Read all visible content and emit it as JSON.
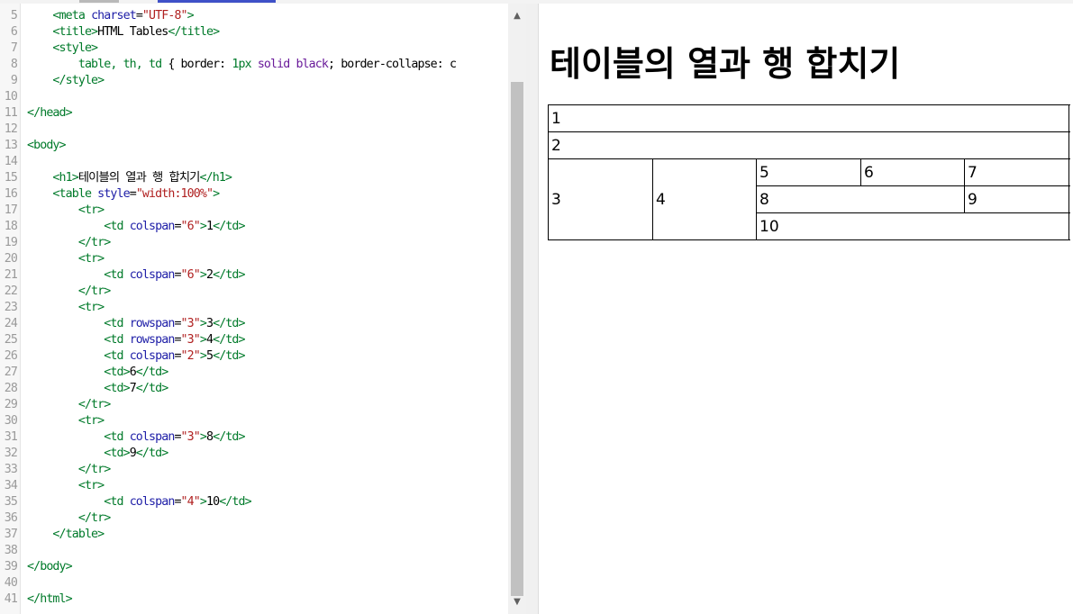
{
  "editor": {
    "lines": [
      {
        "n": "5",
        "tokens": [
          [
            "t",
            "    "
          ],
          [
            "tag",
            "<meta "
          ],
          [
            "attr",
            "charset"
          ],
          [
            "txt",
            "="
          ],
          [
            "str",
            "\"UTF-8\""
          ],
          [
            "tag",
            ">"
          ]
        ]
      },
      {
        "n": "6",
        "tokens": [
          [
            "t",
            "    "
          ],
          [
            "tag",
            "<title>"
          ],
          [
            "txt",
            "HTML Tables"
          ],
          [
            "tag",
            "</title>"
          ]
        ]
      },
      {
        "n": "7",
        "tokens": [
          [
            "t",
            "    "
          ],
          [
            "tag",
            "<style>"
          ]
        ]
      },
      {
        "n": "8",
        "tokens": [
          [
            "t",
            "        "
          ],
          [
            "tag",
            "table, th, td "
          ],
          [
            "txt",
            "{ border: "
          ],
          [
            "tag",
            "1px "
          ],
          [
            "kw",
            "solid "
          ],
          [
            "kw",
            "black"
          ],
          [
            "txt",
            "; border-collapse: c"
          ]
        ]
      },
      {
        "n": "9",
        "tokens": [
          [
            "t",
            "    "
          ],
          [
            "tag",
            "</style>"
          ]
        ]
      },
      {
        "n": "10",
        "tokens": []
      },
      {
        "n": "11",
        "tokens": [
          [
            "tag",
            "</head>"
          ]
        ]
      },
      {
        "n": "12",
        "tokens": []
      },
      {
        "n": "13",
        "tokens": [
          [
            "tag",
            "<body>"
          ]
        ]
      },
      {
        "n": "14",
        "tokens": []
      },
      {
        "n": "15",
        "tokens": [
          [
            "t",
            "    "
          ],
          [
            "tag",
            "<h1>"
          ],
          [
            "txt",
            "테이블의 열과 행 합치기"
          ],
          [
            "tag",
            "</h1>"
          ]
        ]
      },
      {
        "n": "16",
        "tokens": [
          [
            "t",
            "    "
          ],
          [
            "tag",
            "<table "
          ],
          [
            "attr",
            "style"
          ],
          [
            "txt",
            "="
          ],
          [
            "str",
            "\"width:100%\""
          ],
          [
            "tag",
            ">"
          ]
        ]
      },
      {
        "n": "17",
        "tokens": [
          [
            "t",
            "        "
          ],
          [
            "tag",
            "<tr>"
          ]
        ]
      },
      {
        "n": "18",
        "tokens": [
          [
            "t",
            "            "
          ],
          [
            "tag",
            "<td "
          ],
          [
            "attr",
            "colspan"
          ],
          [
            "txt",
            "="
          ],
          [
            "str",
            "\"6\""
          ],
          [
            "tag",
            ">"
          ],
          [
            "txt",
            "1"
          ],
          [
            "tag",
            "</td>"
          ]
        ]
      },
      {
        "n": "19",
        "tokens": [
          [
            "t",
            "        "
          ],
          [
            "tag",
            "</tr>"
          ]
        ]
      },
      {
        "n": "20",
        "tokens": [
          [
            "t",
            "        "
          ],
          [
            "tag",
            "<tr>"
          ]
        ]
      },
      {
        "n": "21",
        "tokens": [
          [
            "t",
            "            "
          ],
          [
            "tag",
            "<td "
          ],
          [
            "attr",
            "colspan"
          ],
          [
            "txt",
            "="
          ],
          [
            "str",
            "\"6\""
          ],
          [
            "tag",
            ">"
          ],
          [
            "txt",
            "2"
          ],
          [
            "tag",
            "</td>"
          ]
        ]
      },
      {
        "n": "22",
        "tokens": [
          [
            "t",
            "        "
          ],
          [
            "tag",
            "</tr>"
          ]
        ]
      },
      {
        "n": "23",
        "tokens": [
          [
            "t",
            "        "
          ],
          [
            "tag",
            "<tr>"
          ]
        ]
      },
      {
        "n": "24",
        "tokens": [
          [
            "t",
            "            "
          ],
          [
            "tag",
            "<td "
          ],
          [
            "attr",
            "rowspan"
          ],
          [
            "txt",
            "="
          ],
          [
            "str",
            "\"3\""
          ],
          [
            "tag",
            ">"
          ],
          [
            "txt",
            "3"
          ],
          [
            "tag",
            "</td>"
          ]
        ]
      },
      {
        "n": "25",
        "tokens": [
          [
            "t",
            "            "
          ],
          [
            "tag",
            "<td "
          ],
          [
            "attr",
            "rowspan"
          ],
          [
            "txt",
            "="
          ],
          [
            "str",
            "\"3\""
          ],
          [
            "tag",
            ">"
          ],
          [
            "txt",
            "4"
          ],
          [
            "tag",
            "</td>"
          ]
        ]
      },
      {
        "n": "26",
        "tokens": [
          [
            "t",
            "            "
          ],
          [
            "tag",
            "<td "
          ],
          [
            "attr",
            "colspan"
          ],
          [
            "txt",
            "="
          ],
          [
            "str",
            "\"2\""
          ],
          [
            "tag",
            ">"
          ],
          [
            "txt",
            "5"
          ],
          [
            "tag",
            "</td>"
          ]
        ]
      },
      {
        "n": "27",
        "tokens": [
          [
            "t",
            "            "
          ],
          [
            "tag",
            "<td>"
          ],
          [
            "txt",
            "6"
          ],
          [
            "tag",
            "</td>"
          ]
        ]
      },
      {
        "n": "28",
        "tokens": [
          [
            "t",
            "            "
          ],
          [
            "tag",
            "<td>"
          ],
          [
            "txt",
            "7"
          ],
          [
            "tag",
            "</td>"
          ]
        ]
      },
      {
        "n": "29",
        "tokens": [
          [
            "t",
            "        "
          ],
          [
            "tag",
            "</tr>"
          ]
        ]
      },
      {
        "n": "30",
        "tokens": [
          [
            "t",
            "        "
          ],
          [
            "tag",
            "<tr>"
          ]
        ]
      },
      {
        "n": "31",
        "tokens": [
          [
            "t",
            "            "
          ],
          [
            "tag",
            "<td "
          ],
          [
            "attr",
            "colspan"
          ],
          [
            "txt",
            "="
          ],
          [
            "str",
            "\"3\""
          ],
          [
            "tag",
            ">"
          ],
          [
            "txt",
            "8"
          ],
          [
            "tag",
            "</td>"
          ]
        ]
      },
      {
        "n": "32",
        "tokens": [
          [
            "t",
            "            "
          ],
          [
            "tag",
            "<td>"
          ],
          [
            "txt",
            "9"
          ],
          [
            "tag",
            "</td>"
          ]
        ]
      },
      {
        "n": "33",
        "tokens": [
          [
            "t",
            "        "
          ],
          [
            "tag",
            "</tr>"
          ]
        ]
      },
      {
        "n": "34",
        "tokens": [
          [
            "t",
            "        "
          ],
          [
            "tag",
            "<tr>"
          ]
        ]
      },
      {
        "n": "35",
        "tokens": [
          [
            "t",
            "            "
          ],
          [
            "tag",
            "<td "
          ],
          [
            "attr",
            "colspan"
          ],
          [
            "txt",
            "="
          ],
          [
            "str",
            "\"4\""
          ],
          [
            "tag",
            ">"
          ],
          [
            "txt",
            "10"
          ],
          [
            "tag",
            "</td>"
          ]
        ]
      },
      {
        "n": "36",
        "tokens": [
          [
            "t",
            "        "
          ],
          [
            "tag",
            "</tr>"
          ]
        ]
      },
      {
        "n": "37",
        "tokens": [
          [
            "t",
            "    "
          ],
          [
            "tag",
            "</table>"
          ]
        ]
      },
      {
        "n": "38",
        "tokens": []
      },
      {
        "n": "39",
        "tokens": [
          [
            "tag",
            "</body>"
          ]
        ]
      },
      {
        "n": "40",
        "tokens": []
      },
      {
        "n": "41",
        "tokens": [
          [
            "tag",
            "</html>"
          ]
        ]
      }
    ]
  },
  "scrollbar": {
    "up_icon": "▲",
    "down_icon": "▼"
  },
  "preview": {
    "heading": "테이블의 열과 행 합치기",
    "cells": {
      "c1": "1",
      "c2": "2",
      "c3": "3",
      "c4": "4",
      "c5": "5",
      "c6": "6",
      "c7": "7",
      "c8": "8",
      "c9": "9",
      "c10": "10"
    }
  },
  "colors": {
    "tag": "#007a2a",
    "attr": "#2020a8",
    "string": "#b02020",
    "scroll_thumb": "#c1c1c1",
    "tab_accent": "#3f51c8"
  }
}
